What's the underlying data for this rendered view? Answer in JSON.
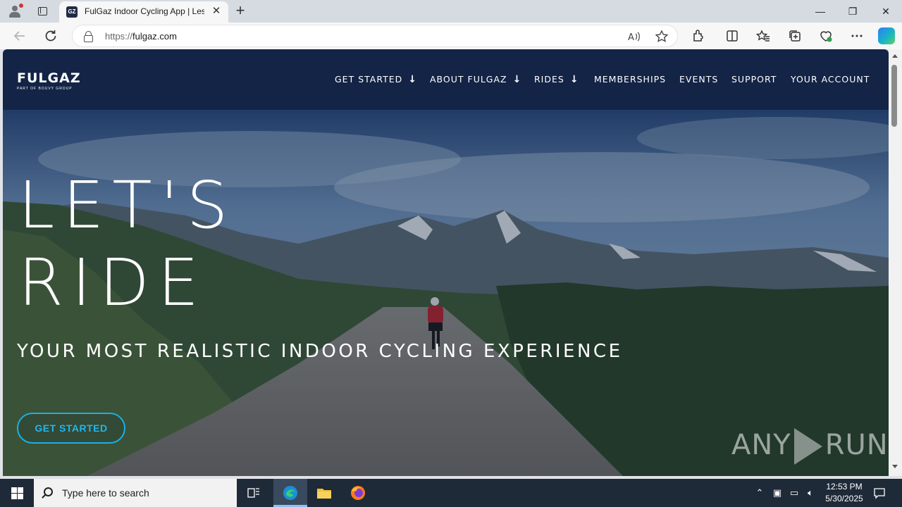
{
  "browser": {
    "tab_title": "FulGaz Indoor Cycling App | Les",
    "tab_favicon": "GZ",
    "tab_close_glyph": "✕",
    "new_tab_glyph": "+",
    "url_scheme": "https://",
    "url_host": "fulgaz.com",
    "window_minimize": "—",
    "window_restore": "❐",
    "window_close": "✕",
    "icons": [
      "profile-icon",
      "tab-actions-icon",
      "back-icon",
      "refresh-icon",
      "lock-icon",
      "read-aloud-icon",
      "favorite-star-icon",
      "extensions-icon",
      "split-screen-icon",
      "favorites-icon",
      "collections-icon",
      "browser-essentials-icon",
      "more-icon",
      "copilot-icon"
    ]
  },
  "site": {
    "logo": {
      "word": "FULGAZ",
      "tagline": "PART OF BOUVY GROUP"
    },
    "nav": [
      {
        "label": "GET STARTED",
        "has_dropdown": true
      },
      {
        "label": "ABOUT FULGAZ",
        "has_dropdown": true
      },
      {
        "label": "RIDES",
        "has_dropdown": true
      },
      {
        "label": "MEMBERSHIPS",
        "has_dropdown": false
      },
      {
        "label": "EVENTS",
        "has_dropdown": false
      },
      {
        "label": "SUPPORT",
        "has_dropdown": false
      },
      {
        "label": "YOUR ACCOUNT",
        "has_dropdown": false
      }
    ],
    "chevron": "↓",
    "hero": {
      "headline_line1": "LET'S",
      "headline_line2": "RIDE",
      "subheadline": "YOUR MOST REALISTIC INDOOR CYCLING EXPERIENCE",
      "cta_label": "GET STARTED"
    },
    "colors": {
      "header_bg": "#132446",
      "cta_accent": "#1ab0e6"
    }
  },
  "watermark": {
    "left": "ANY",
    "right": "RUN"
  },
  "taskbar": {
    "search_placeholder": "Type here to search",
    "time": "12:53 PM",
    "date": "5/30/2025",
    "apps": [
      "task-view-icon",
      "edge-icon",
      "file-explorer-icon",
      "firefox-icon"
    ]
  }
}
